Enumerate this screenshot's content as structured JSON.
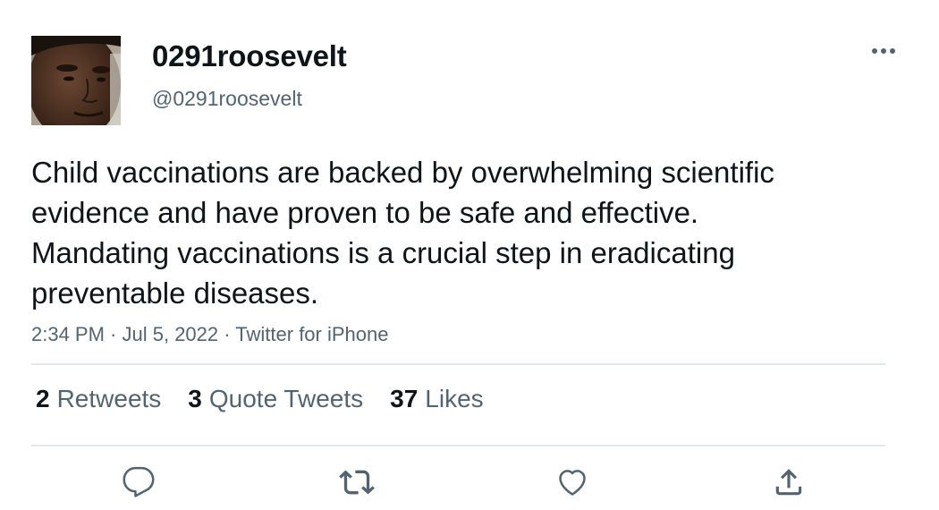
{
  "user": {
    "display_name": "0291roosevelt",
    "handle": "@0291roosevelt",
    "avatar": "avatar-photo"
  },
  "tweet": {
    "text": "Child vaccinations are backed by overwhelming scientific evidence and have proven to be safe and effective. Mandating vaccinations is a crucial step in eradicating preventable diseases.",
    "time": "2:34 PM",
    "date": "Jul 5, 2022",
    "source": "Twitter for iPhone",
    "separator": " · "
  },
  "stats": {
    "retweets": {
      "count": "2",
      "label": "Retweets"
    },
    "quote_tweets": {
      "count": "3",
      "label": "Quote Tweets"
    },
    "likes": {
      "count": "37",
      "label": "Likes"
    }
  },
  "icons": {
    "more": "more-horizontal-icon",
    "reply": "reply-icon",
    "retweet": "retweet-icon",
    "like": "heart-icon",
    "share": "share-icon"
  },
  "colors": {
    "text_primary": "#0f1419",
    "text_secondary": "#536471",
    "divider": "#e4e7ea"
  }
}
